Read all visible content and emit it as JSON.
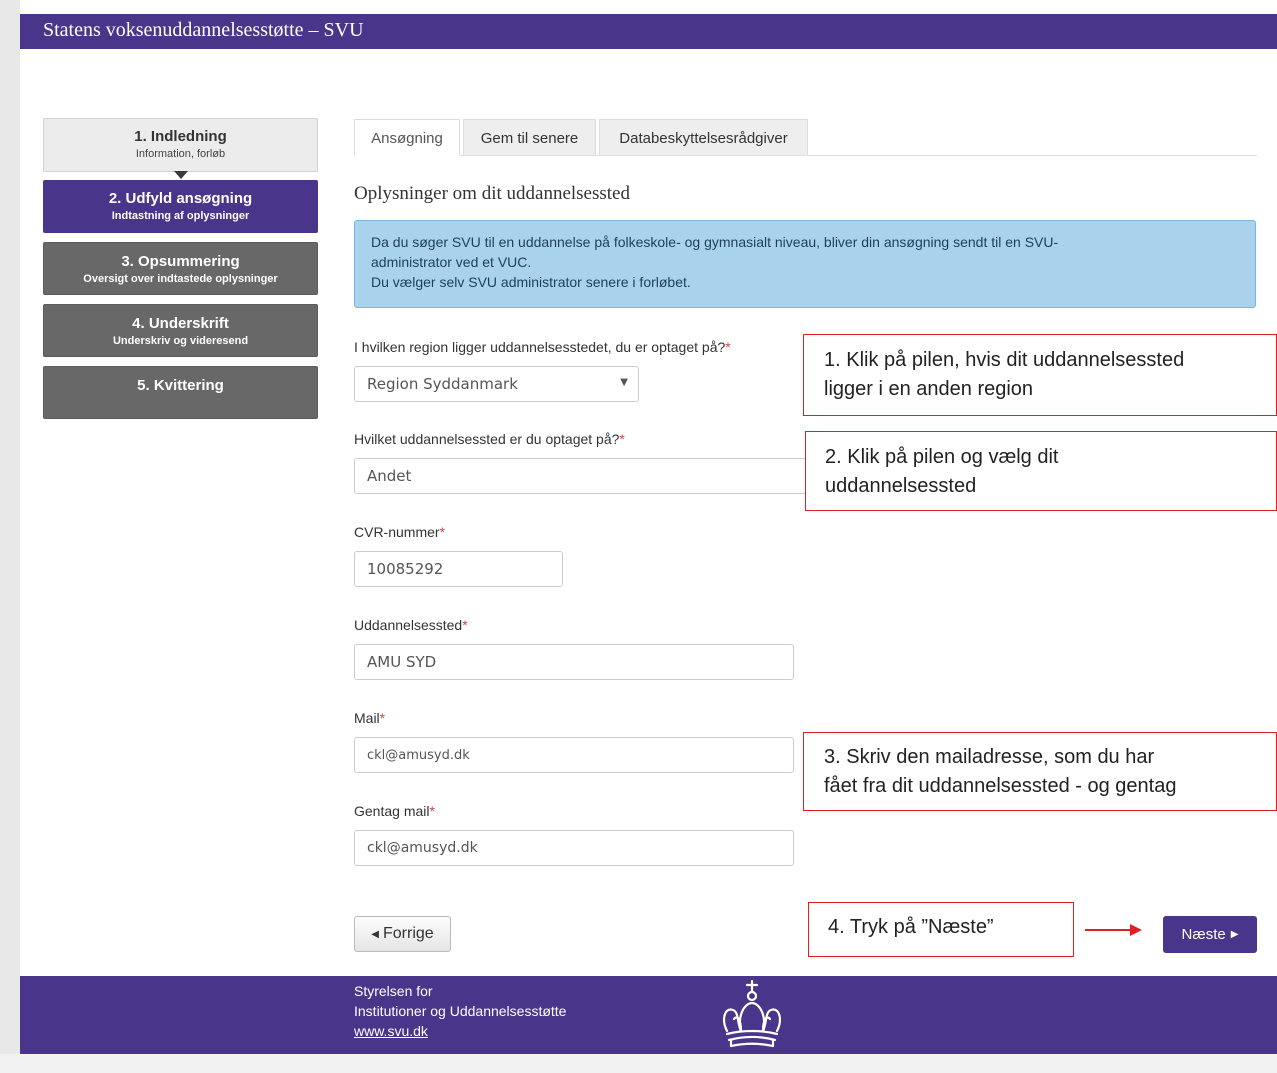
{
  "header": {
    "title": "Statens voksenuddannelsesstøtte – SVU"
  },
  "steps": [
    {
      "title": "1. Indledning",
      "subtitle": "Information, forløb",
      "state": "done"
    },
    {
      "title": "2. Udfyld ansøgning",
      "subtitle": "Indtastning af oplysninger",
      "state": "active"
    },
    {
      "title": "3. Opsummering",
      "subtitle": "Oversigt over indtastede oplysninger",
      "state": "todo"
    },
    {
      "title": "4. Underskrift",
      "subtitle": "Underskriv og videresend",
      "state": "todo"
    },
    {
      "title": "5. Kvittering",
      "subtitle": "",
      "state": "todo"
    }
  ],
  "tabs": [
    {
      "label": "Ansøgning",
      "active": true
    },
    {
      "label": "Gem til senere",
      "active": false
    },
    {
      "label": "Databeskyttelsesrådgiver",
      "active": false
    }
  ],
  "form": {
    "section_title": "Oplysninger om dit uddannelsessted",
    "info_lines": [
      "Da du søger SVU til en uddannelse på folkeskole- og gymnasialt niveau, bliver din ansøgning sendt til en SVU-",
      "administrator ved et VUC.",
      "Du vælger selv SVU administrator senere i forløbet."
    ],
    "required_mark": "*",
    "region": {
      "label": "I hvilken region ligger uddannelsesstedet, du er optaget på?",
      "value": "Region Syddanmark"
    },
    "institution": {
      "label": "Hvilket uddannelsessted er du optaget på?",
      "value": "Andet"
    },
    "cvr": {
      "label": "CVR-nummer",
      "value": "10085292"
    },
    "place": {
      "label": "Uddannelsessted",
      "value": "AMU SYD"
    },
    "mail": {
      "label": "Mail",
      "value": "ckl@amusyd.dk"
    },
    "mail_repeat": {
      "label": "Gentag mail",
      "value": "ckl@amusyd.dk"
    }
  },
  "buttons": {
    "prev": "Forrige",
    "next": "Næste"
  },
  "callouts": {
    "c1": [
      "1. Klik på pilen, hvis dit uddannelsessted",
      "ligger i en anden region"
    ],
    "c2": [
      "2. Klik på pilen og vælg dit",
      "uddannelsessted"
    ],
    "c3": [
      "3. Skriv den mailadresse, som du har",
      "fået fra dit uddannelsessted - og gentag"
    ],
    "c4": "4. Tryk på ”Næste”"
  },
  "footer": {
    "line1": "Styrelsen for",
    "line2": "Institutioner og Uddannelsesstøtte",
    "link": "www.svu.dk"
  },
  "colors": {
    "brand": "#49368a",
    "callout_border": "#e02020",
    "info_bg": "#a9d3ed"
  }
}
